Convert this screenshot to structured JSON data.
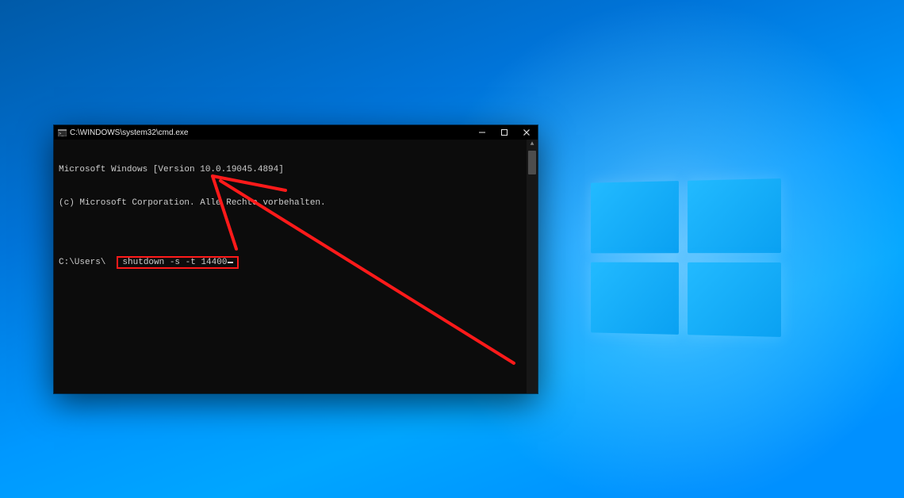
{
  "window": {
    "title": "C:\\WINDOWS\\system32\\cmd.exe",
    "icon": "cmd-icon",
    "controls": {
      "minimize": "minimize",
      "maximize": "maximize",
      "close": "close"
    }
  },
  "terminal": {
    "line1": "Microsoft Windows [Version 10.0.19045.4894]",
    "line2": "(c) Microsoft Corporation. Alle Rechte vorbehalten.",
    "blank": "",
    "prompt": "C:\\Users\\",
    "command": "shutdown -s -t 14400"
  },
  "annotation": {
    "highlight_color": "#ff1a1a",
    "arrow_color": "#ff1a1a"
  }
}
